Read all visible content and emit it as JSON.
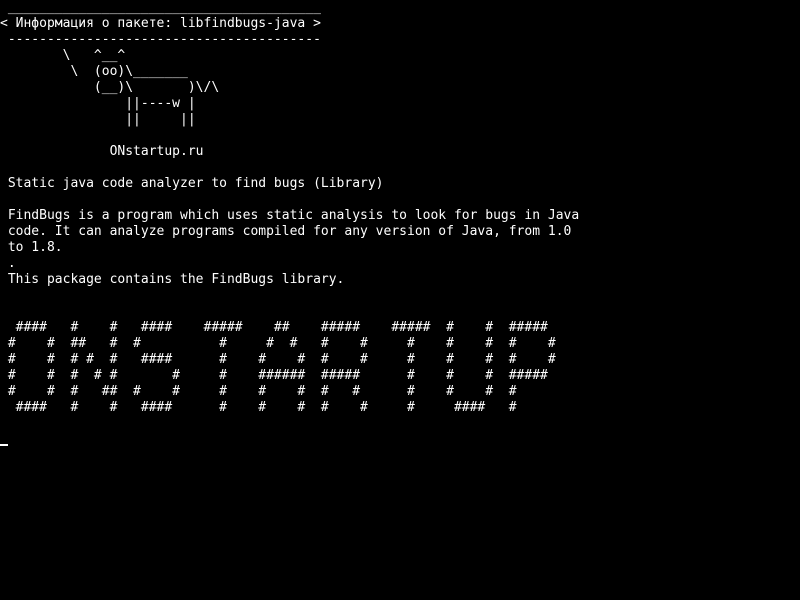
{
  "terminal": {
    "lines": [
      " ________________________________________",
      "< Информация о пакете: libfindbugs-java >",
      " ----------------------------------------",
      "        \\   ^__^",
      "         \\  (oo)\\_______",
      "            (__)\\       )\\/\\",
      "                ||----w |",
      "                ||     ||",
      "",
      "              ONstartup.ru",
      "",
      " Static java code analyzer to find bugs (Library)",
      "",
      " FindBugs is a program which uses static analysis to look for bugs in Java",
      " code. It can analyze programs compiled for any version of Java, from 1.0",
      " to 1.8.",
      " .",
      " This package contains the FindBugs library.",
      "",
      "",
      "  ####   #    #   ####    #####    ##    #####    #####  #    #  #####",
      " #    #  ##   #  #          #     #  #   #    #     #    #    #  #    #",
      " #    #  # #  #   ####      #    #    #  #    #     #    #    #  #    #",
      " #    #  #  # #       #     #    ######  #####      #    #    #  #####",
      " #    #  #   ##  #    #     #    #    #  #   #      #    #    #  #",
      "  ####   #    #   ####      #    #    #  #    #     #     ####   #"
    ]
  }
}
